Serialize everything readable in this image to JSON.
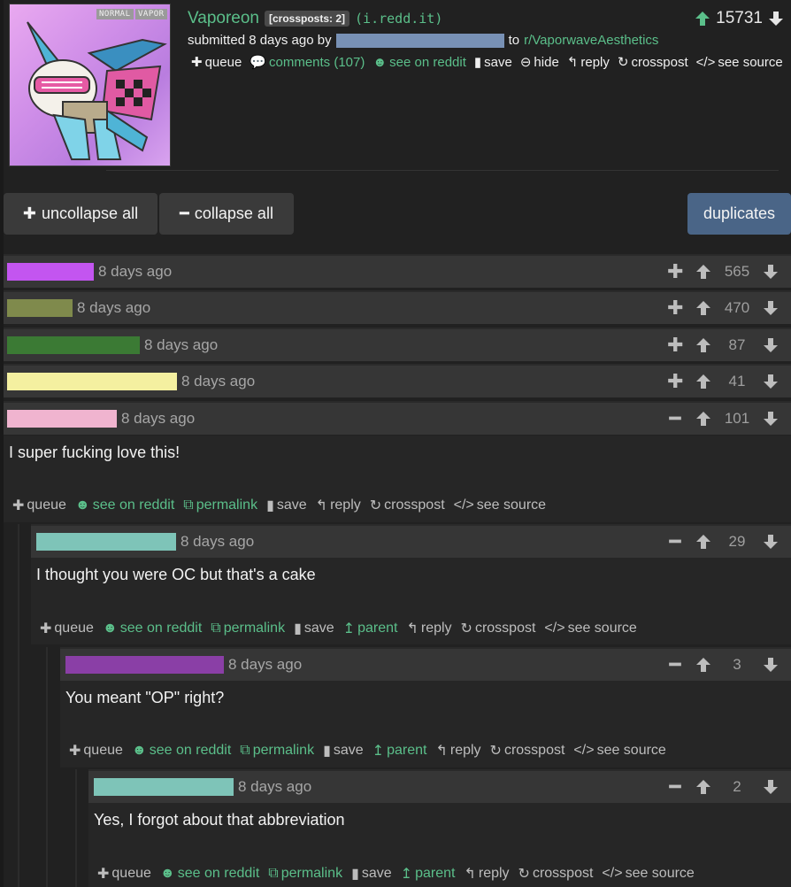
{
  "post": {
    "title": "Vaporeon",
    "crosspost_badge": "[crossposts: 2]",
    "domain": "(i.redd.it)",
    "score": "15731",
    "submitted_prefix": "submitted 8 days ago by",
    "to_text": "to",
    "subreddit": "r/VaporwaveAesthetics",
    "thumbnail_tags": [
      "NORMAL",
      "VAPOR"
    ],
    "actions": {
      "queue": "queue",
      "comments": "comments (107)",
      "see_on_reddit": "see on reddit",
      "save": "save",
      "hide": "hide",
      "reply": "reply",
      "crosspost": "crosspost",
      "see_source": "see source"
    }
  },
  "controls": {
    "uncollapse_all": "uncollapse all",
    "collapse_all": "collapse all",
    "duplicates": "duplicates"
  },
  "collapsed_comments": [
    {
      "age": "8 days ago",
      "score": "565",
      "bar_color": "#c355f0"
    },
    {
      "age": "8 days ago",
      "score": "470",
      "bar_color": "#7f8a4c"
    },
    {
      "age": "8 days ago",
      "score": "87",
      "bar_color": "#3b7a34"
    },
    {
      "age": "8 days ago",
      "score": "41",
      "bar_color": "#f4f0a0"
    },
    {
      "age": "8 days ago",
      "score": "101",
      "bar_color": "#f0b4cf"
    }
  ],
  "thread": [
    {
      "age": "8 days ago",
      "score": "101",
      "bar_color": "#f0b4cf",
      "text": "I super fucking love this!"
    },
    {
      "age": "8 days ago",
      "score": "29",
      "bar_color": "#7ec4b8",
      "text": "I thought you were OC but that's a cake"
    },
    {
      "age": "8 days ago",
      "score": "3",
      "bar_color": "#8a3fa6",
      "text": "You meant \"OP\" right?"
    },
    {
      "age": "8 days ago",
      "score": "2",
      "bar_color": "#7ec4b8",
      "text": "Yes, I forgot about that abbreviation"
    }
  ],
  "comment_actions": {
    "queue": "queue",
    "see_on_reddit": "see on reddit",
    "permalink": "permalink",
    "save": "save",
    "parent": "parent",
    "reply": "reply",
    "crosspost": "crosspost",
    "see_source": "see source"
  },
  "colors": {
    "accent": "#5bbf8a",
    "background": "#212121",
    "row": "#363636",
    "duplicates": "#4a6587"
  }
}
